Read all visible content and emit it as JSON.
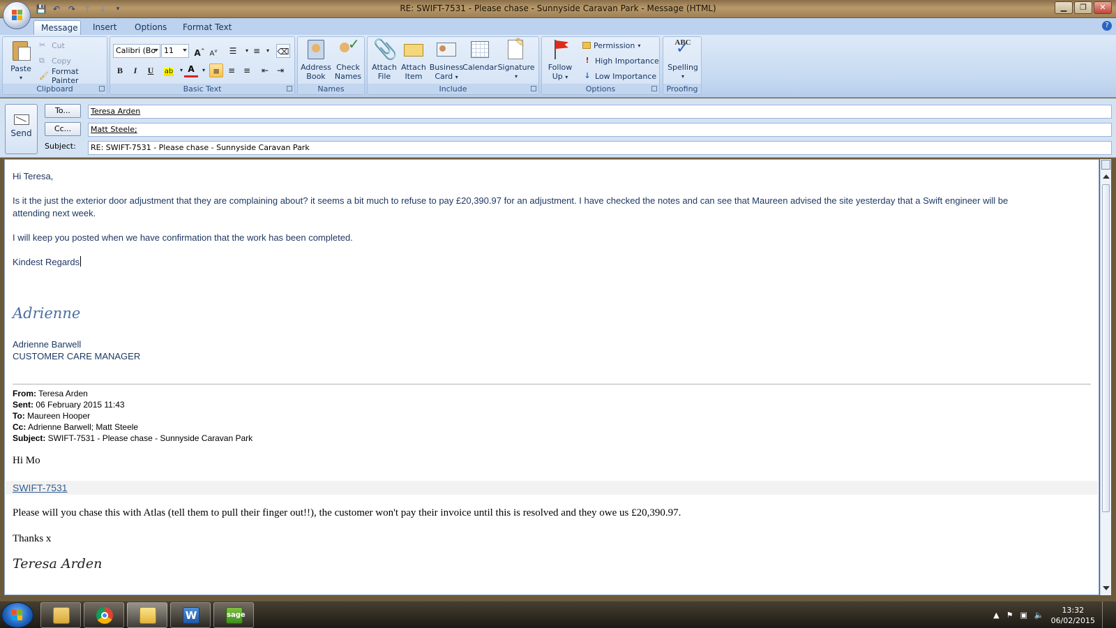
{
  "window": {
    "title": "RE: SWIFT-7531 - Please chase - Sunnyside Caravan Park - Message (HTML)",
    "controls": [
      "minimize-icon",
      "restore-icon",
      "close-icon"
    ]
  },
  "quick_access": [
    "save-icon",
    "undo-icon",
    "redo-icon",
    "up-arrow-icon",
    "down-arrow-icon",
    "customize-icon"
  ],
  "tabs": [
    {
      "label": "Message",
      "active": true
    },
    {
      "label": "Insert"
    },
    {
      "label": "Options"
    },
    {
      "label": "Format Text"
    }
  ],
  "ribbon": {
    "clipboard": {
      "label": "Clipboard",
      "paste": "Paste",
      "cut": "Cut",
      "copy": "Copy",
      "format_painter": "Format Painter"
    },
    "basic_text": {
      "label": "Basic Text",
      "font": "Calibri (Bo",
      "size": "11",
      "bold": "B",
      "italic": "I",
      "underline": "U",
      "font_color_glyph": "A"
    },
    "names": {
      "label": "Names",
      "address_book": [
        "Address",
        "Book"
      ],
      "check_names": [
        "Check",
        "Names"
      ]
    },
    "include": {
      "label": "Include",
      "attach_file": [
        "Attach",
        "File"
      ],
      "attach_item": [
        "Attach",
        "Item"
      ],
      "business_card": [
        "Business",
        "Card"
      ],
      "calendar": "Calendar",
      "signature": "Signature"
    },
    "options": {
      "label": "Options",
      "follow_up": [
        "Follow",
        "Up"
      ],
      "permission": "Permission",
      "high_importance": "High Importance",
      "low_importance": "Low Importance"
    },
    "proofing": {
      "label": "Proofing",
      "spelling": "Spelling",
      "abc": "ABC"
    }
  },
  "header": {
    "send": "Send",
    "to_button": "To...",
    "cc_button": "Cc...",
    "subject_label": "Subject:",
    "to_value": "Teresa Arden",
    "cc_value": "Matt Steele;",
    "subject_value": "RE: SWIFT-7531 - Please chase - Sunnyside Caravan Park"
  },
  "body": {
    "greeting": "Hi Teresa,",
    "para1_line1": "Is it the just the exterior door adjustment  that they are complaining about? it seems a bit much to refuse to pay £20,390.97 for an adjustment.  I have checked the notes and can see that Maureen advised the site yesterday that a Swift engineer will be",
    "para1_line2": "attending next week.",
    "para2": "I will keep you posted when we have confirmation that the work has been completed.",
    "closing": "Kindest Regards",
    "signature_script": "Adrienne",
    "sig_name": "Adrienne Barwell",
    "sig_title": "CUSTOMER CARE MANAGER"
  },
  "quoted": {
    "from_label": "From:",
    "from": " Teresa Arden",
    "sent_label": "Sent:",
    "sent": " 06 February 2015 11:43",
    "to_label": "To:",
    "to": " Maureen Hooper",
    "cc_label": "Cc:",
    "cc": " Adrienne Barwell; Matt Steele",
    "subject_label": "Subject:",
    "subject": " SWIFT-7531 - Please chase - Sunnyside Caravan Park",
    "greeting": "Hi Mo",
    "link": "SWIFT-7531",
    "message": "Please will you chase this with Atlas (tell them to pull their finger out!!), the customer won't pay their invoice until this is resolved and they owe us £20,390.97.",
    "thanks": "Thanks x",
    "signature_script": "Teresa Arden"
  },
  "taskbar": {
    "apps": [
      "explorer-icon",
      "chrome-icon",
      "outlook-icon",
      "word-icon",
      "sage-icon"
    ],
    "time": "13:32",
    "date": "06/02/2015"
  }
}
